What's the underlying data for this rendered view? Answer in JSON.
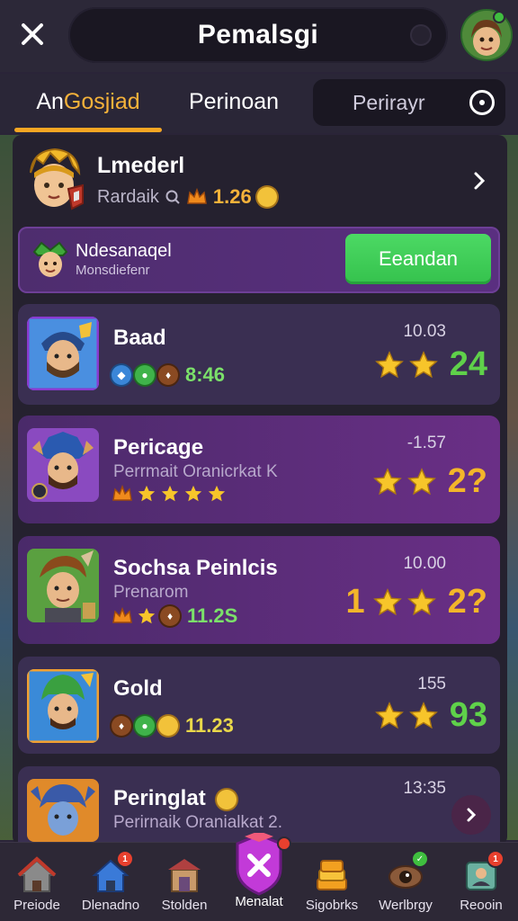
{
  "header": {
    "title": "Pemalsgi"
  },
  "tabs": [
    {
      "label_part1": "An ",
      "label_part2": "Gosjiad"
    },
    {
      "label": "Perinoan"
    },
    {
      "label": "Perirayr"
    }
  ],
  "profile": {
    "name": "Lmederl",
    "sub_label": "Rardaik",
    "value": "1.26"
  },
  "promo": {
    "title": "Ndesanaqel",
    "subtitle": "Monsdiefenr",
    "button_label": "Eeandan"
  },
  "rows": [
    {
      "name": "Baad",
      "sub": "",
      "stat": "8:46",
      "time": "10.03",
      "score": "24",
      "score_prefix": ""
    },
    {
      "name": "Pericage",
      "sub": "Perrmait Oranicrkat K",
      "stat": "",
      "time": "-1.57",
      "score": "2?",
      "score_prefix": ""
    },
    {
      "name": "Sochsa Peinlcis",
      "sub": "Prenarom",
      "stat": "11.2S",
      "time": "10.00",
      "score": "2?",
      "score_prefix": "1"
    },
    {
      "name": "Gold",
      "sub": "",
      "stat": "11.23",
      "time": "155",
      "score": "93",
      "score_prefix": ""
    },
    {
      "name": "Peringlat",
      "sub": "Perirnaik Oranialkat 2.",
      "stat": "",
      "time": "13:35",
      "score": "",
      "score_prefix": ""
    }
  ],
  "bottom_nav": [
    {
      "label": "Preiode"
    },
    {
      "label": "Dlenadno"
    },
    {
      "label": "Stolden"
    },
    {
      "label": "Menalat"
    },
    {
      "label": "Sigobrks"
    },
    {
      "label": "Werlbrgy"
    },
    {
      "label": "Reooin"
    }
  ],
  "colors": {
    "accent_orange": "#f5a623",
    "button_green": "#4cd964",
    "score_green": "#5fd14a",
    "score_gold": "#f3b52a",
    "row_purple": "#6a2f86"
  },
  "icons": {
    "close": "close-icon",
    "arrow": "chevron-right-icon",
    "star": "star-icon"
  }
}
